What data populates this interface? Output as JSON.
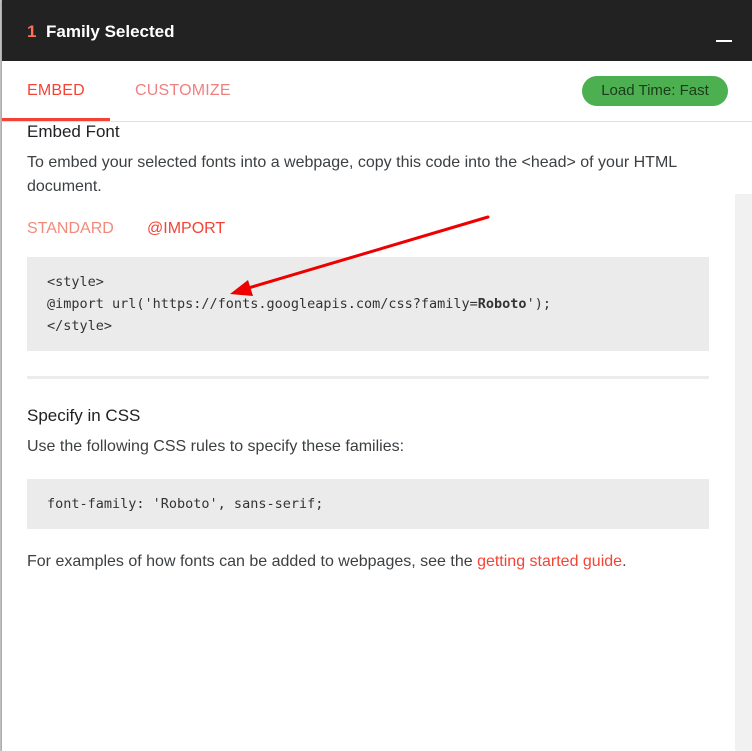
{
  "header": {
    "count": "1",
    "title": "Family Selected",
    "minimize_icon": "minimize-icon"
  },
  "tabs": [
    {
      "label": "EMBED",
      "active": true
    },
    {
      "label": "CUSTOMIZE",
      "active": false
    }
  ],
  "load_time_badge": "Load Time: Fast",
  "embed": {
    "heading": "Embed Font",
    "description": "To embed your selected fonts into a webpage, copy this code into the <head> of your HTML document.",
    "subtabs": [
      "STANDARD",
      "@IMPORT"
    ],
    "active_subtab": "@IMPORT",
    "code_lines": {
      "line1": "<style>",
      "line2_prefix": "@import url('https://fonts.googleapis.com/css?family=",
      "line2_family": "Roboto",
      "line2_suffix": "');",
      "line3": "</style>"
    }
  },
  "specify": {
    "heading": "Specify in CSS",
    "description": "Use the following CSS rules to specify these families:",
    "code": "font-family: 'Roboto', sans-serif;"
  },
  "footer": {
    "text_before": "For examples of how fonts can be added to webpages, see the ",
    "link_text": "getting started guide",
    "text_after": "."
  },
  "colors": {
    "accent": "#f44336",
    "header_bg": "#222222",
    "badge_bg": "#4caf50",
    "code_bg": "#ebebeb",
    "annotation_arrow": "#ee0000"
  }
}
